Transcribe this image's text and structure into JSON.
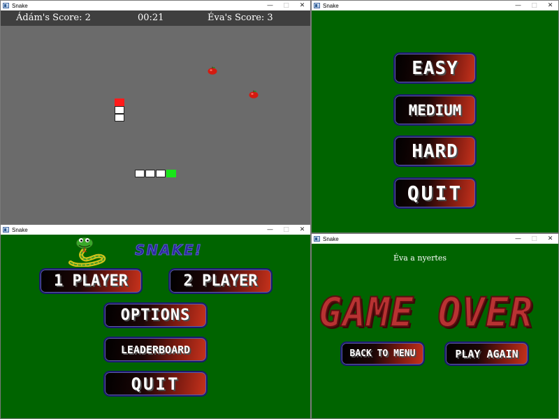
{
  "windows": {
    "game": {
      "title": "Snake",
      "player1_score": "Ádám's Score: 2",
      "timer": "00:21",
      "player2_score": "Éva's Score: 3"
    },
    "difficulty": {
      "title": "Snake",
      "buttons": [
        "EASY",
        "MEDIUM",
        "HARD",
        "QUIT"
      ]
    },
    "main_menu": {
      "title": "Snake",
      "logo_text": "SNAKE!",
      "one_player": "1 PLAYER",
      "two_player": "2 PLAYER",
      "options": "OPTIONS",
      "leaderboard": "LEADERBOARD",
      "quit": "QUIT"
    },
    "game_over": {
      "title": "Snake",
      "winner_text": "Éva a nyertes",
      "heading": "GAME OVER",
      "back_to_menu": "BACK TO MENU",
      "play_again": "PLAY AGAIN"
    }
  },
  "controls": {
    "minimize": "—",
    "maximize": "□",
    "close": "✕"
  },
  "colors": {
    "menu_background": "#006400",
    "game_background": "#6b6b6b",
    "score_bar": "#3f3f3f",
    "snake1_head": "#ff1a1a",
    "snake2_head": "#19e619",
    "game_over_text": "#b83232"
  },
  "icons": [
    "snake-app-icon",
    "apple-icon",
    "snake-logo-icon"
  ]
}
